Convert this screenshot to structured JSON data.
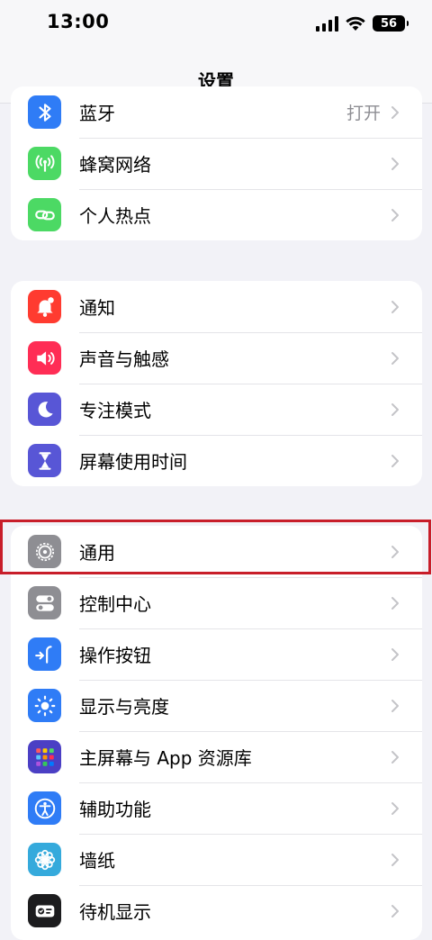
{
  "status": {
    "time": "13:00",
    "battery": "56"
  },
  "nav": {
    "title": "设置"
  },
  "group1": [
    {
      "label": "蓝牙",
      "value": "打开",
      "icon": "bluetooth-icon",
      "color": "#2f7cf6"
    },
    {
      "label": "蜂窝网络",
      "icon": "antenna-icon",
      "color": "#4cd964"
    },
    {
      "label": "个人热点",
      "icon": "link-icon",
      "color": "#4cd964"
    }
  ],
  "group2": [
    {
      "label": "通知",
      "icon": "bell-icon",
      "color": "#ff3b30"
    },
    {
      "label": "声音与触感",
      "icon": "speaker-icon",
      "color": "#ff2d55"
    },
    {
      "label": "专注模式",
      "icon": "moon-icon",
      "color": "#5856d6"
    },
    {
      "label": "屏幕使用时间",
      "icon": "hourglass-icon",
      "color": "#5856d6"
    }
  ],
  "group3": [
    {
      "label": "通用",
      "icon": "gear-icon",
      "color": "#8e8e93"
    },
    {
      "label": "控制中心",
      "icon": "toggles-icon",
      "color": "#8e8e93"
    },
    {
      "label": "操作按钮",
      "icon": "action-button-icon",
      "color": "#2f7cf6"
    },
    {
      "label": "显示与亮度",
      "icon": "sun-icon",
      "color": "#2f7cf6"
    },
    {
      "label": "主屏幕与 App 资源库",
      "icon": "app-grid-icon",
      "color": "#5856d6"
    },
    {
      "label": "辅助功能",
      "icon": "accessibility-icon",
      "color": "#2f7cf6"
    },
    {
      "label": "墙纸",
      "icon": "flower-icon",
      "color": "#35aadc"
    },
    {
      "label": "待机显示",
      "icon": "standby-icon",
      "color": "#1c1c1e"
    }
  ]
}
